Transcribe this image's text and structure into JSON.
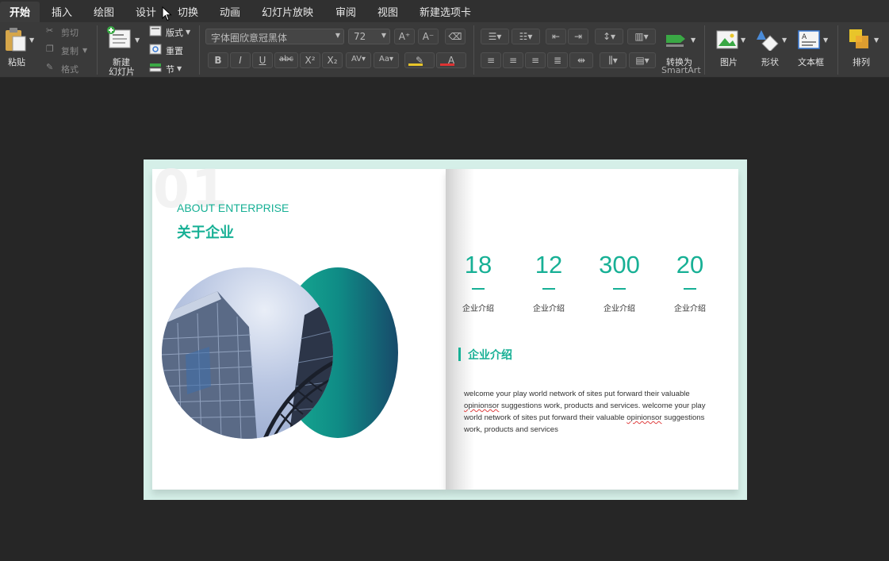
{
  "tabs": [
    "开始",
    "插入",
    "绘图",
    "设计",
    "切换",
    "动画",
    "幻灯片放映",
    "审阅",
    "视图",
    "新建选项卡"
  ],
  "ribbon": {
    "paste": "粘贴",
    "cut": "剪切",
    "copy": "复制",
    "format": "格式",
    "new_slide_line1": "新建",
    "new_slide_line2": "幻灯片",
    "layout": "版式",
    "reset": "重置",
    "section": "节",
    "font_name": "字体圈欣意冠黑体",
    "font_size": "72",
    "convert_line1": "转换为",
    "convert_line2": "SmartArt",
    "picture": "图片",
    "shapes": "形状",
    "textbox": "文本框",
    "arrange": "排列"
  },
  "slide": {
    "big_number": "01",
    "about_en": "ABOUT ENTERPRISE",
    "about_cn": "关于企业",
    "stats": [
      {
        "value": "18",
        "label": "企业介绍"
      },
      {
        "value": "12",
        "label": "企业介绍"
      },
      {
        "value": "300",
        "label": "企业介绍"
      },
      {
        "value": "20",
        "label": "企业介绍"
      }
    ],
    "section_title": "企业介绍",
    "body": {
      "p1": "welcome your play world network of sites put forward their valuable ",
      "w1": "opinionsor",
      "p2": " suggestions work, products and services. welcome your play world network of sites put forward their valuable ",
      "w2": "opinionsor",
      "p3": " suggestions work, products and services"
    }
  },
  "colors": {
    "accent": "#17b095",
    "ribbon_bg": "#3a3a3a",
    "canvas_bg": "#262626"
  }
}
